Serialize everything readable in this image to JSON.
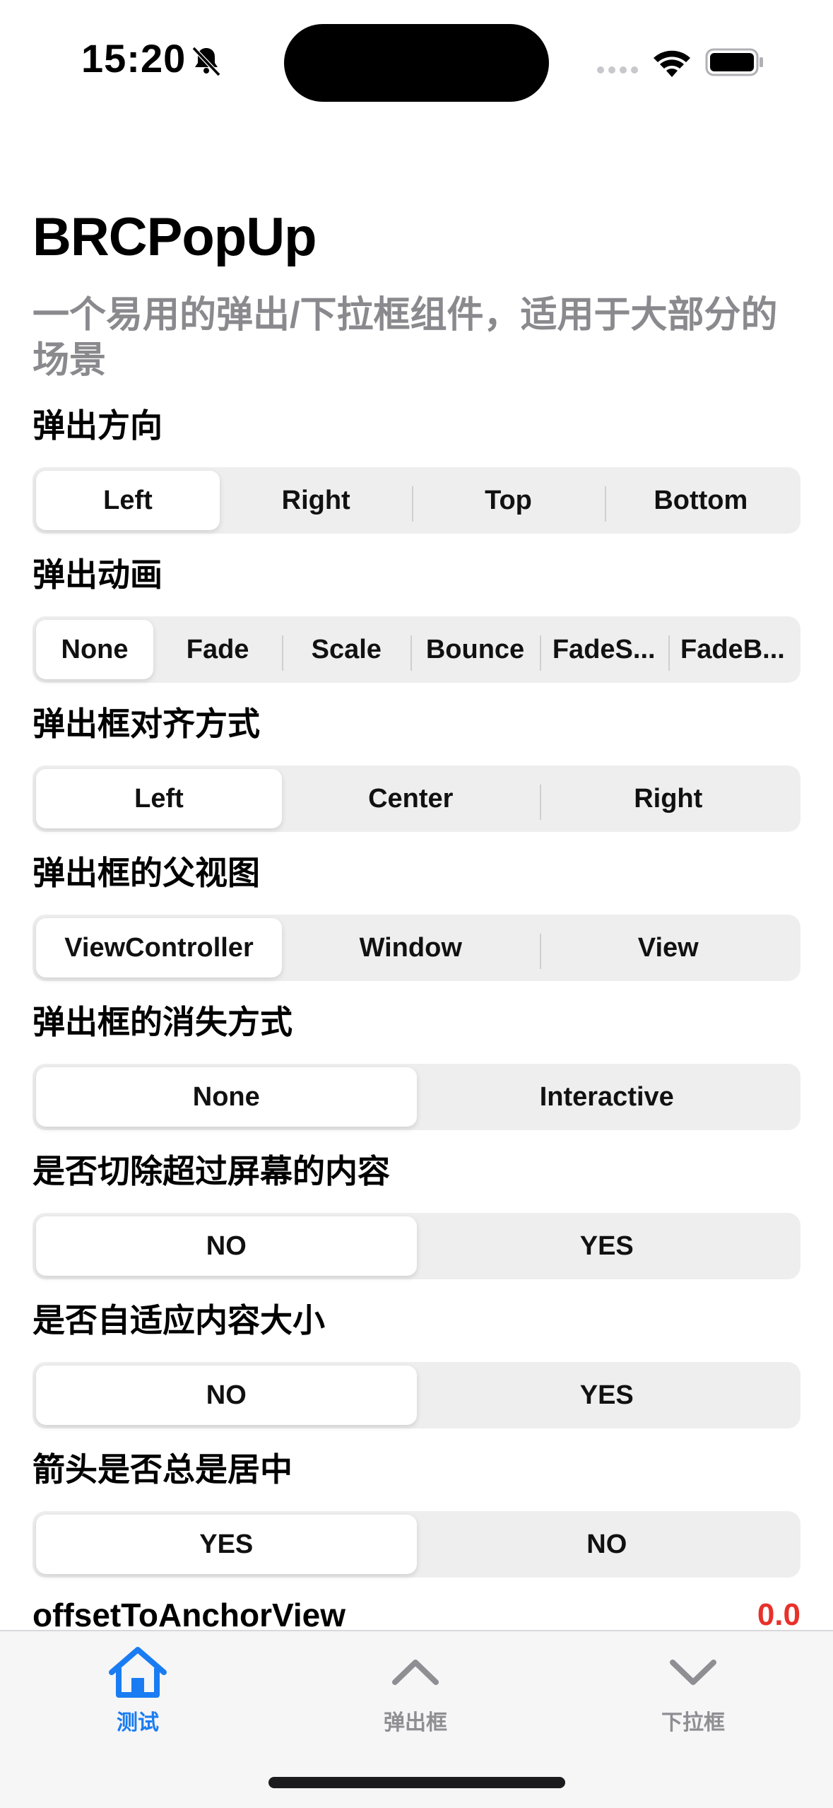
{
  "status_bar": {
    "time": "15:20"
  },
  "header": {
    "title": "BRCPopUp",
    "subtitle": "一个易用的弹出/下拉框组件，适用于大部分的场景"
  },
  "sections": [
    {
      "label": "弹出方向",
      "options": [
        "Left",
        "Right",
        "Top",
        "Bottom"
      ],
      "selected": 0
    },
    {
      "label": "弹出动画",
      "options": [
        "None",
        "Fade",
        "Scale",
        "Bounce",
        "FadeS...",
        "FadeB..."
      ],
      "selected": 0
    },
    {
      "label": "弹出框对齐方式",
      "options": [
        "Left",
        "Center",
        "Right"
      ],
      "selected": 0
    },
    {
      "label": "弹出框的父视图",
      "options": [
        "ViewController",
        "Window",
        "View"
      ],
      "selected": 0
    },
    {
      "label": "弹出框的消失方式",
      "options": [
        "None",
        "Interactive"
      ],
      "selected": 0
    },
    {
      "label": "是否切除超过屏幕的内容",
      "options": [
        "NO",
        "YES"
      ],
      "selected": 0
    },
    {
      "label": "是否自适应内容大小",
      "options": [
        "NO",
        "YES"
      ],
      "selected": 0
    },
    {
      "label": "箭头是否总是居中",
      "options": [
        "YES",
        "NO"
      ],
      "selected": 0
    }
  ],
  "offset": {
    "label": "offsetToAnchorView",
    "value": "0.0"
  },
  "tabbar": {
    "tabs": [
      {
        "label": "测试",
        "icon": "home-icon",
        "active": true
      },
      {
        "label": "弹出框",
        "icon": "chevron-up-icon",
        "active": false
      },
      {
        "label": "下拉框",
        "icon": "chevron-down-icon",
        "active": false
      }
    ],
    "active_color": "#1a7cf2",
    "inactive_color": "#8e8e93"
  },
  "colors": {
    "accent": "#1a7cf2",
    "value_red": "#e8312a",
    "subtitle_gray": "#8a8a8e"
  }
}
